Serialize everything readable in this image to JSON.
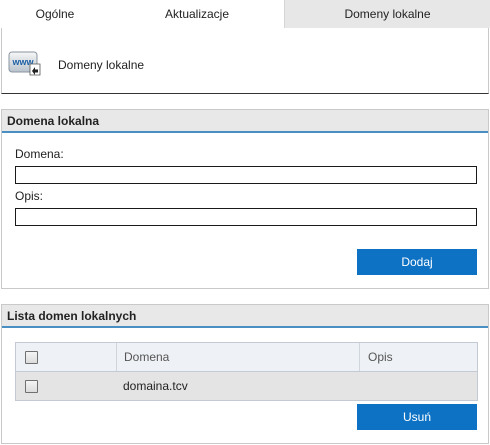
{
  "tabs": [
    {
      "label": "Ogólne",
      "active": false
    },
    {
      "label": "Aktualizacje",
      "active": false
    },
    {
      "label": "Domeny lokalne",
      "active": true
    }
  ],
  "header": {
    "title": "Domeny lokalne",
    "icon": "www-globe-icon",
    "icon_text": "www"
  },
  "local_domain_form": {
    "title": "Domena lokalna",
    "domain_label": "Domena:",
    "domain_value": "",
    "description_label": "Opis:",
    "description_value": "",
    "add_button": "Dodaj"
  },
  "domain_list": {
    "title": "Lista domen lokalnych",
    "columns": [
      "Domena",
      "Opis"
    ],
    "rows": [
      {
        "domain": "domaina.tcv",
        "description": "",
        "checked": false
      }
    ],
    "delete_button": "Usuń"
  },
  "colors": {
    "accent": "#0d72c4",
    "panel_underline": "#4a8fc3",
    "active_tab": "#e7e7e7"
  }
}
